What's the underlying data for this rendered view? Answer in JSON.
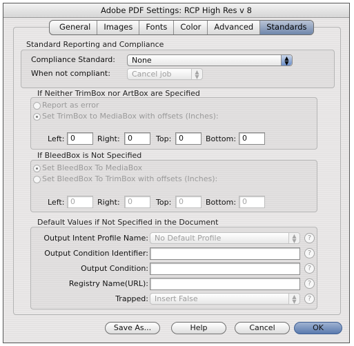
{
  "window": {
    "title": "Adobe PDF Settings: RCP High Res v 8"
  },
  "tabs": [
    "General",
    "Images",
    "Fonts",
    "Color",
    "Advanced",
    "Standards"
  ],
  "standards": {
    "section_title": "Standard Reporting and Compliance",
    "compliance_label": "Compliance Standard:",
    "compliance_value": "None",
    "noncompliant_label": "When not compliant:",
    "noncompliant_value": "Cancel job"
  },
  "trimbox": {
    "title": "If Neither TrimBox nor ArtBox are Specified",
    "option1": "Report as error",
    "option2": "Set TrimBox to MediaBox with offsets (Inches):",
    "left_label": "Left:",
    "left_value": "0",
    "right_label": "Right:",
    "right_value": "0",
    "top_label": "Top:",
    "top_value": "0",
    "bottom_label": "Bottom:",
    "bottom_value": "0"
  },
  "bleedbox": {
    "title": "If BleedBox is Not Specified",
    "option1": "Set BleedBox To MediaBox",
    "option2": "Set BleedBox To TrimBox with offsets (Inches):",
    "left_label": "Left:",
    "left_value": "0",
    "right_label": "Right:",
    "right_value": "0",
    "top_label": "Top:",
    "top_value": "0",
    "bottom_label": "Bottom:",
    "bottom_value": "0"
  },
  "defaults": {
    "title": "Default Values if Not Specified in the Document",
    "intent_label": "Output Intent Profile Name:",
    "intent_value": "No Default Profile",
    "cond_id_label": "Output Condition Identifier:",
    "cond_id_value": "",
    "cond_label": "Output Condition:",
    "cond_value": "",
    "registry_label": "Registry Name(URL):",
    "registry_value": "",
    "trapped_label": "Trapped:",
    "trapped_value": "Insert False",
    "help_glyph": "?"
  },
  "buttons": {
    "save_as": "Save As...",
    "help": "Help",
    "cancel": "Cancel",
    "ok": "OK"
  },
  "colors": {
    "accent": "#6f86ab",
    "ok_button": "#5a7aae"
  }
}
